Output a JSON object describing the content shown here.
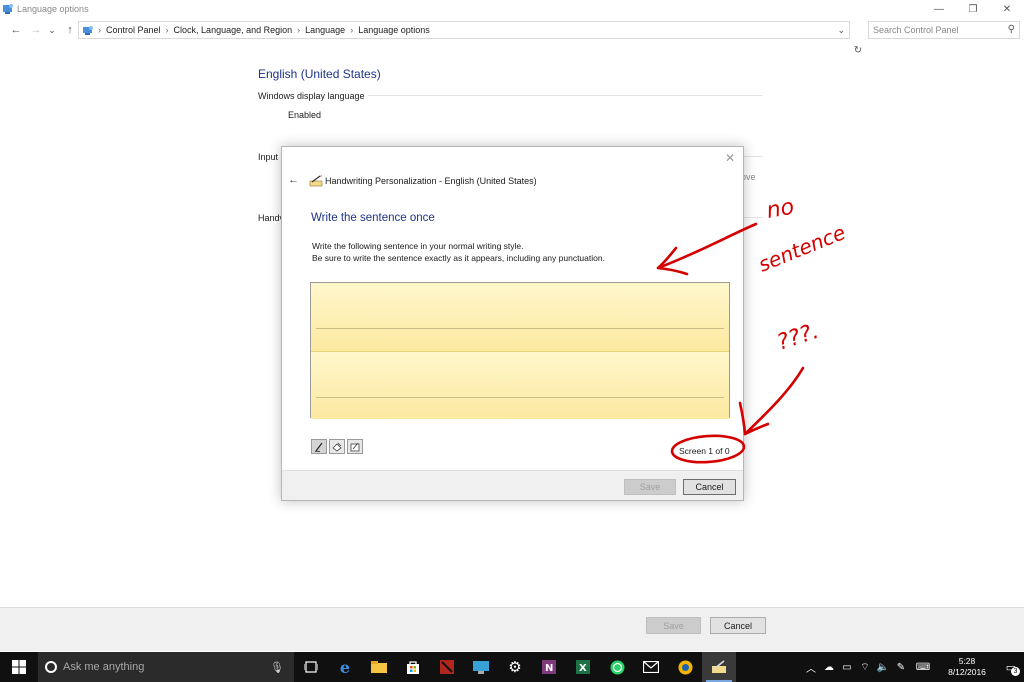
{
  "window": {
    "title": "Language options",
    "controls": {
      "minimize": "—",
      "restore": "❐",
      "close": "✕"
    }
  },
  "nav": {
    "back": "←",
    "forward": "→",
    "recent": "⌄",
    "up": "↑",
    "breadcrumbs": [
      "Control Panel",
      "Clock, Language, and Region",
      "Language",
      "Language options"
    ],
    "separator": "›",
    "dropdown": "⌄",
    "refresh": "↻",
    "search_placeholder": "Search Control Panel"
  },
  "content": {
    "language_heading": "English (United States)",
    "display_language_label": "Windows display language",
    "display_language_value": "Enabled",
    "input_label": "Input",
    "remove_text": "ove",
    "handwriting_label": "Handv"
  },
  "dialog": {
    "title": "Handwriting Personalization - English (United States)",
    "back": "←",
    "close": "✕",
    "heading": "Write the sentence once",
    "instruction_line1": "Write the following sentence in your normal writing style.",
    "instruction_line2": "Be sure to write the sentence exactly as it appears, including any punctuation.",
    "tools": [
      "pen-tool",
      "eraser-tool",
      "clear-tool"
    ],
    "screen_count": "Screen 1 of 0",
    "save_label": "Save",
    "cancel_label": "Cancel"
  },
  "footer": {
    "save_label": "Save",
    "cancel_label": "Cancel"
  },
  "annotations": {
    "text1": "no",
    "text2": "sentence",
    "text3": "???.",
    "color": "#d40000"
  },
  "taskbar": {
    "search_placeholder": "Ask me anything",
    "apps": [
      "task-view",
      "edge",
      "file-explorer",
      "store",
      "dota",
      "remote-desktop",
      "settings",
      "onenote",
      "excel",
      "whatsapp",
      "mail",
      "maps",
      "handwriting"
    ],
    "time": "5:28",
    "date": "8/12/2016",
    "notification_count": "3"
  }
}
